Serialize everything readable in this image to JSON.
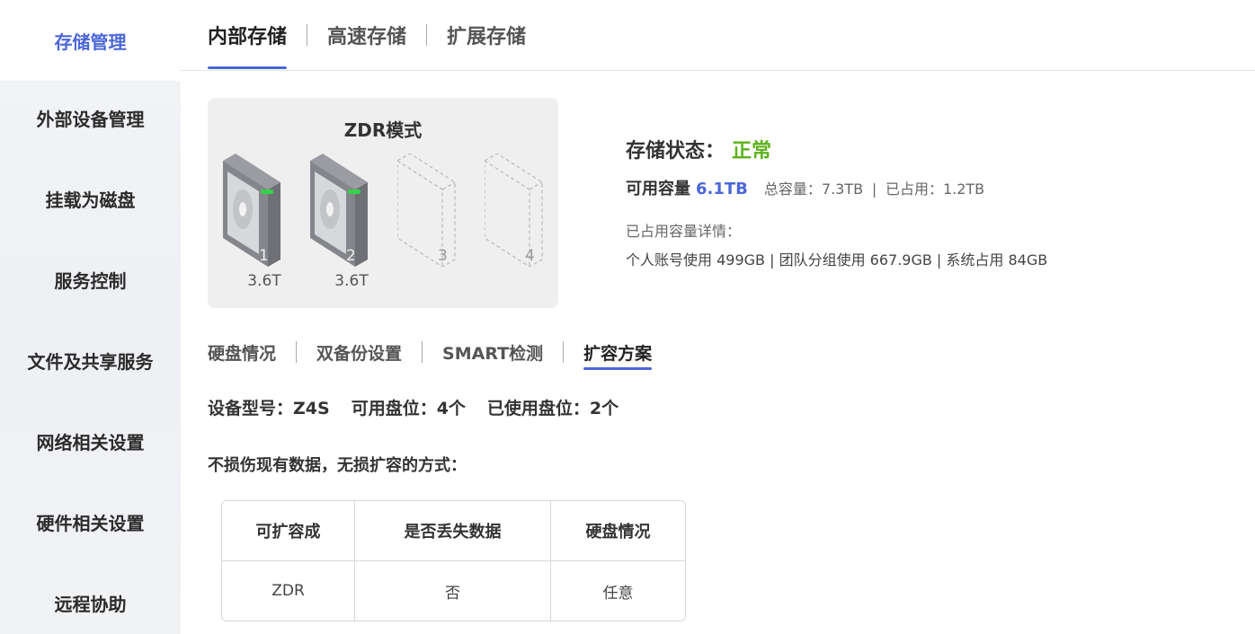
{
  "sidebar": {
    "items": [
      {
        "label": "存储管理",
        "active": true
      },
      {
        "label": "外部设备管理"
      },
      {
        "label": "挂载为磁盘"
      },
      {
        "label": "服务控制"
      },
      {
        "label": "文件及共享服务"
      },
      {
        "label": "网络相关设置"
      },
      {
        "label": "硬件相关设置"
      },
      {
        "label": "远程协助"
      }
    ]
  },
  "top_tabs": [
    {
      "label": "内部存储",
      "active": true
    },
    {
      "label": "高速存储"
    },
    {
      "label": "扩展存储"
    }
  ],
  "disk_card": {
    "mode": "ZDR模式",
    "slots": [
      {
        "number": "1",
        "capacity": "3.6T",
        "installed": true
      },
      {
        "number": "2",
        "capacity": "3.6T",
        "installed": true
      },
      {
        "number": "3",
        "capacity": "",
        "installed": false
      },
      {
        "number": "4",
        "capacity": "",
        "installed": false
      }
    ]
  },
  "status": {
    "label": "存储状态：",
    "value": "正常",
    "available_label": "可用容量",
    "available_value": "6.1TB",
    "total_text": "总容量：7.3TB",
    "used_text": "已占用：1.2TB",
    "sep": "|",
    "detail_title": "已占用容量详情：",
    "detail_text": "个人账号使用 499GB | 团队分组使用 667.9GB | 系统占用 84GB"
  },
  "sub_tabs": [
    {
      "label": "硬盘情况"
    },
    {
      "label": "双备份设置"
    },
    {
      "label": "SMART检测"
    },
    {
      "label": "扩容方案",
      "active": true
    }
  ],
  "device": {
    "model": "设备型号：Z4S",
    "slots_available": "可用盘位：4个",
    "slots_used": "已使用盘位：2个"
  },
  "method_title": "不损伤现有数据，无损扩容的方式：",
  "table": {
    "headers": [
      "可扩容成",
      "是否丢失数据",
      "硬盘情况"
    ],
    "rows": [
      [
        "ZDR",
        "否",
        "任意"
      ]
    ]
  },
  "colors": {
    "accent": "#4b66d8",
    "status_ok": "#5cb21a"
  }
}
